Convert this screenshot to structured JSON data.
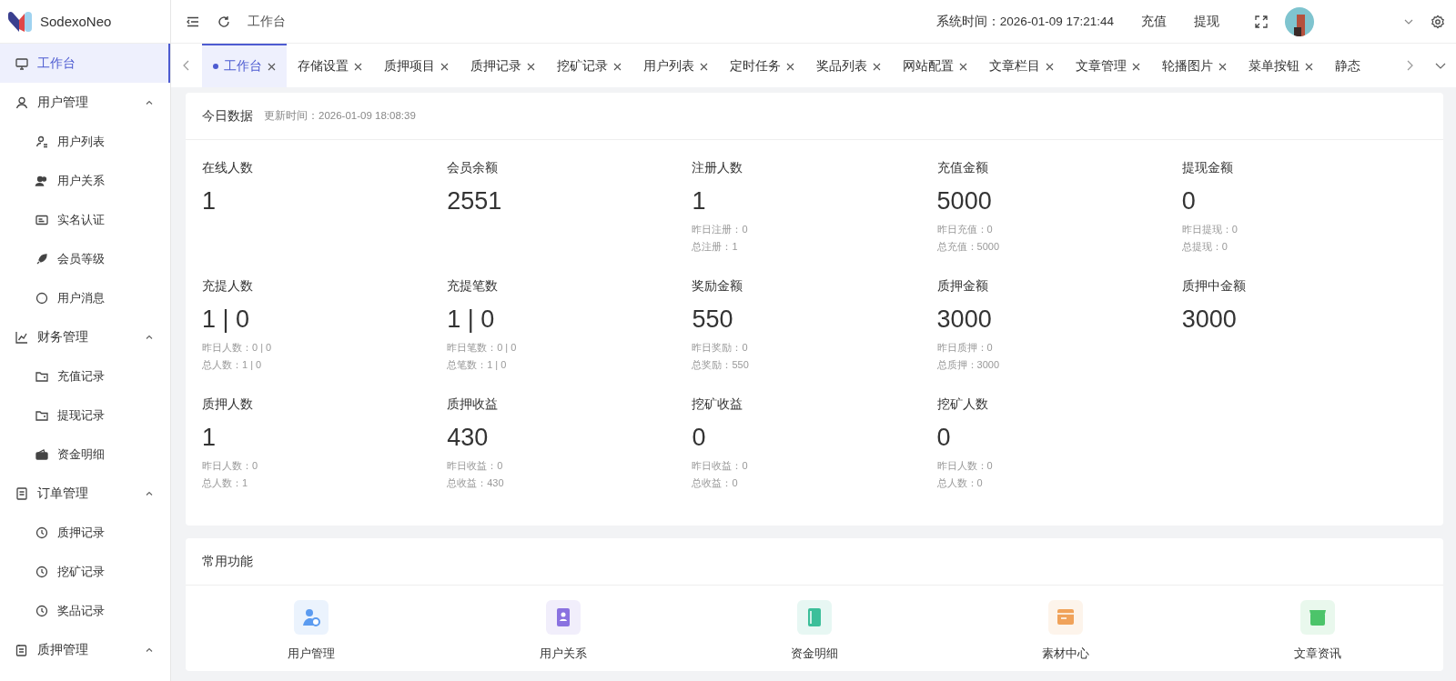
{
  "brand": {
    "name": "SodexoNeo"
  },
  "sidebar": {
    "items": [
      {
        "label": "工作台",
        "selected": true
      },
      {
        "label": "用户管理",
        "expanded": true,
        "selected": false,
        "children": [
          {
            "label": "用户列表",
            "selected": false
          },
          {
            "label": "用户关系",
            "selected": false
          },
          {
            "label": "实名认证",
            "selected": false
          },
          {
            "label": "会员等级",
            "selected": false
          },
          {
            "label": "用户消息",
            "selected": false
          }
        ]
      },
      {
        "label": "财务管理",
        "expanded": true,
        "selected": false,
        "children": [
          {
            "label": "充值记录",
            "selected": false
          },
          {
            "label": "提现记录",
            "selected": false
          },
          {
            "label": "资金明细",
            "selected": false
          }
        ]
      },
      {
        "label": "订单管理",
        "expanded": true,
        "selected": false,
        "children": [
          {
            "label": "质押记录",
            "selected": false
          },
          {
            "label": "挖矿记录",
            "selected": false
          },
          {
            "label": "奖品记录",
            "selected": false
          }
        ]
      },
      {
        "label": "质押管理",
        "expanded": true,
        "selected": false
      }
    ]
  },
  "header": {
    "breadcrumb": "工作台",
    "system_time": "系统时间：2026-01-09 17:21:44",
    "links": [
      "充值",
      "提现"
    ]
  },
  "tabs": [
    {
      "label": "工作台",
      "selected": true
    },
    {
      "label": "存储设置",
      "selected": false
    },
    {
      "label": "质押项目",
      "selected": false
    },
    {
      "label": "质押记录",
      "selected": false
    },
    {
      "label": "挖矿记录",
      "selected": false
    },
    {
      "label": "用户列表",
      "selected": false
    },
    {
      "label": "定时任务",
      "selected": false
    },
    {
      "label": "奖品列表",
      "selected": false
    },
    {
      "label": "网站配置",
      "selected": false
    },
    {
      "label": "文章栏目",
      "selected": false
    },
    {
      "label": "文章管理",
      "selected": false
    },
    {
      "label": "轮播图片",
      "selected": false
    },
    {
      "label": "菜单按钮",
      "selected": false
    },
    {
      "label": "静态",
      "selected": false
    }
  ],
  "today": {
    "title": "今日数据",
    "updated": "更新时间：2026-01-09 18:08:39",
    "stats": [
      {
        "label": "在线人数",
        "value": "1"
      },
      {
        "label": "会员余额",
        "value": "2551"
      },
      {
        "label": "注册人数",
        "value": "1",
        "notes": [
          "昨日注册：0",
          "总注册：1"
        ]
      },
      {
        "label": "充值金额",
        "value": "5000",
        "notes": [
          "昨日充值：0",
          "总充值：5000"
        ]
      },
      {
        "label": "提现金额",
        "value": "0",
        "notes": [
          "昨日提现：0",
          "总提现：0"
        ]
      },
      {
        "label": "充提人数",
        "value": "1 | 0",
        "notes": [
          "昨日人数：0 | 0",
          "总人数：1 | 0"
        ]
      },
      {
        "label": "充提笔数",
        "value": "1 | 0",
        "notes": [
          "昨日笔数：0 | 0",
          "总笔数：1 | 0"
        ]
      },
      {
        "label": "奖励金额",
        "value": "550",
        "notes": [
          "昨日奖励：0",
          "总奖励：550"
        ]
      },
      {
        "label": "质押金额",
        "value": "3000",
        "notes": [
          "昨日质押：0",
          "总质押：3000"
        ]
      },
      {
        "label": "质押中金额",
        "value": "3000"
      },
      {
        "label": "质押人数",
        "value": "1",
        "notes": [
          "昨日人数：0",
          "总人数：1"
        ]
      },
      {
        "label": "质押收益",
        "value": "430",
        "notes": [
          "昨日收益：0",
          "总收益：430"
        ]
      },
      {
        "label": "挖矿收益",
        "value": "0",
        "notes": [
          "昨日收益：0",
          "总收益：0"
        ]
      },
      {
        "label": "挖矿人数",
        "value": "0",
        "notes": [
          "昨日人数：0",
          "总人数：0"
        ]
      }
    ]
  },
  "shortcuts": {
    "title": "常用功能",
    "items": [
      {
        "label": "用户管理"
      },
      {
        "label": "用户关系"
      },
      {
        "label": "资金明细"
      },
      {
        "label": "素材中心"
      },
      {
        "label": "文章资讯"
      }
    ]
  }
}
